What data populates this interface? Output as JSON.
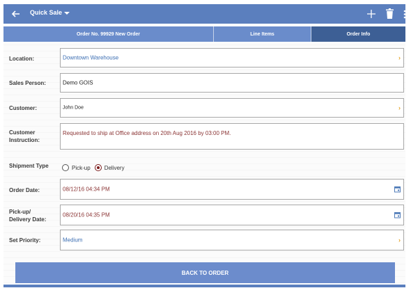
{
  "appbar": {
    "title": "Quick Sale"
  },
  "tabs": [
    {
      "label": "Order No. 99929 New Order"
    },
    {
      "label": "Line Items"
    },
    {
      "label": "Order Info"
    }
  ],
  "form": {
    "location": {
      "label": "Location:",
      "value": "Downtown Warehouse"
    },
    "sales_person": {
      "label": "Sales Person:",
      "value": "Demo  GOIS"
    },
    "customer": {
      "label": "Customer:",
      "value": "John Doe"
    },
    "customer_instruction": {
      "label1": "Customer",
      "label2": "Instruction:",
      "value": "Requested to ship at Office address on 20th Aug 2016 by 03:00 PM."
    },
    "shipment_type": {
      "label": "Shipment Type",
      "options": [
        "Pick-up",
        "Delivery"
      ],
      "selected": "Delivery"
    },
    "order_date": {
      "label": "Order Date:",
      "value": "08/12/16 04:34 PM"
    },
    "pickup_date": {
      "label1": "Pick-up/",
      "label2": "Delivery Date:",
      "value": "08/20/16 04:35 PM"
    },
    "priority": {
      "label": "Set Priority:",
      "value": "Medium"
    }
  },
  "actions": {
    "back_to_order": "BACK TO ORDER"
  },
  "icons": {
    "chevron": "›"
  },
  "colors": {
    "appbar": "#5b7fbe",
    "tab_active": "#3d5f95",
    "button": "#6c8ccc",
    "chevron": "#e6a52a"
  }
}
